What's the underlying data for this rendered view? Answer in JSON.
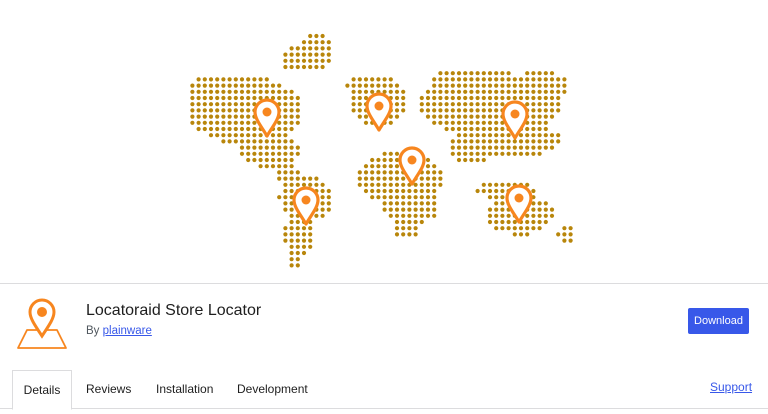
{
  "colors": {
    "dot": "#b8860b",
    "pin": "#f7861f",
    "accent": "#3858e9"
  },
  "banner": {
    "icons": [
      "world-map-dots",
      "map-pin-icon"
    ]
  },
  "plugin": {
    "title": "Locatoraid Store Locator",
    "by_label": "By",
    "author": "plainware",
    "download_label": "Download"
  },
  "tabs": [
    {
      "label": "Details",
      "active": true
    },
    {
      "label": "Reviews",
      "active": false
    },
    {
      "label": "Installation",
      "active": false
    },
    {
      "label": "Development",
      "active": false
    }
  ],
  "support_label": "Support"
}
